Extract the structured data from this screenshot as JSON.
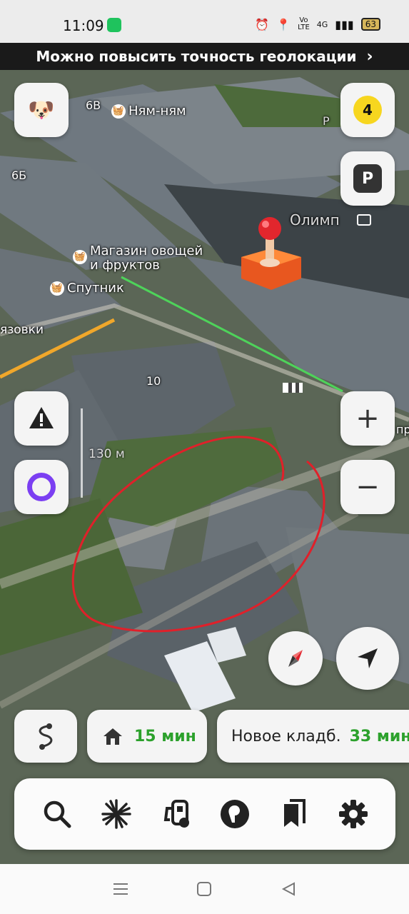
{
  "status_bar": {
    "time": "11:09",
    "network_top": "Vo",
    "network_bottom": "LTE",
    "signal_type": "4G",
    "battery": "63"
  },
  "banner": {
    "text": "Можно повысить точность геолокации",
    "chevron": "›"
  },
  "map": {
    "pois": [
      {
        "label": "Ням-ням",
        "icon": "basket-icon"
      },
      {
        "label": "Магазин овощей",
        "label2": "и фруктов",
        "icon": "basket-icon"
      },
      {
        "label": "Спутник",
        "icon": "basket-icon"
      }
    ],
    "place_labels": {
      "house_6v": "6В",
      "house_6b": "6Б",
      "house_10": "10",
      "olimp": "Олимп",
      "street_partial": "язовки",
      "street_right": "пр",
      "parking_letter": "P"
    },
    "scale": "130 м",
    "traffic_level": "4",
    "parking_label": "P",
    "zoom_in": "+",
    "zoom_out": "−"
  },
  "routes": {
    "home_time": "15 мин",
    "destination_name": "Новое кладб.",
    "destination_time": "33 мин"
  },
  "toolbar": {
    "items": [
      "search-icon",
      "explore-icon",
      "gas-station-icon",
      "navigator-icon",
      "bookmarks-icon",
      "settings-icon"
    ]
  },
  "colors": {
    "accent_green": "#2ca12c",
    "traffic_yellow": "#f7d61f",
    "alice_purple": "#7b3ff2",
    "annotation_red": "#e0202a"
  }
}
